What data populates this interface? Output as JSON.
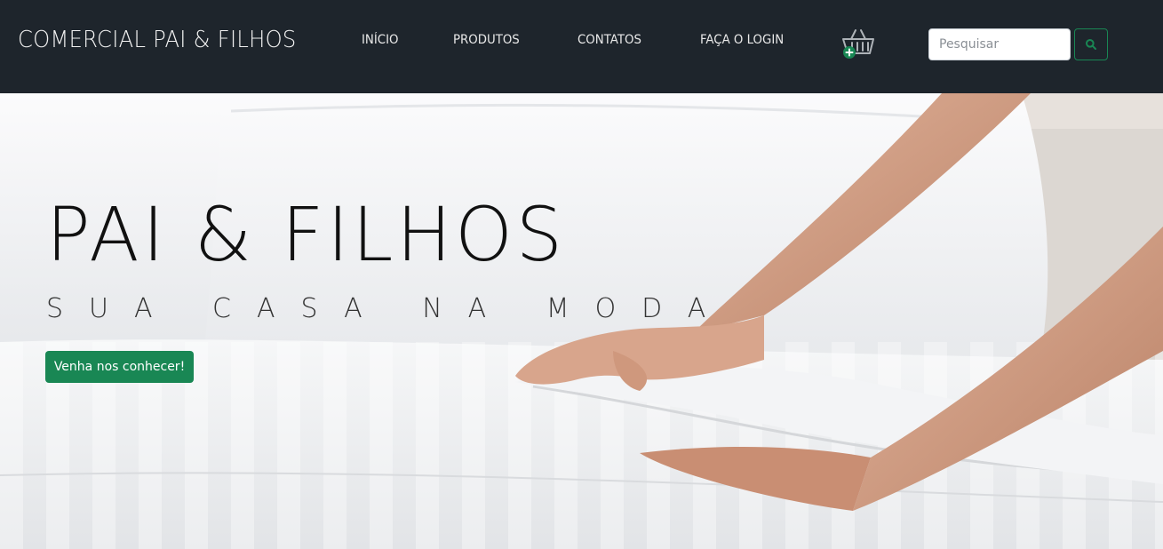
{
  "header": {
    "brand": "COMERCIAL PAI & FILHOS",
    "nav": [
      {
        "label": "INÍCIO"
      },
      {
        "label": "PRODUTOS"
      },
      {
        "label": "CONTATOS"
      },
      {
        "label": "FAÇA O LOGIN"
      }
    ],
    "cart_icon": "shopping-basket-plus-icon",
    "search": {
      "placeholder": "Pesquisar",
      "value": "",
      "button_icon": "search-icon"
    }
  },
  "hero": {
    "title": "PAI & FILHOS",
    "subtitle": "SUA CASA NA MODA",
    "cta_label": "Venha nos conhecer!"
  },
  "colors": {
    "navbar_bg": "#1e252c",
    "accent_green": "#198754",
    "nav_text": "#e8e8e8"
  }
}
